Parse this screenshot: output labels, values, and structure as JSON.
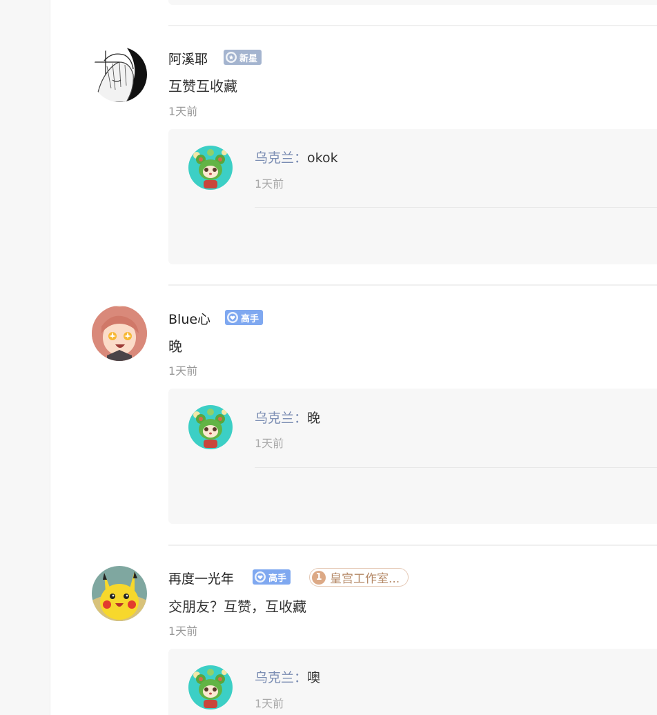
{
  "comments": [
    {
      "username": "阿溪耶",
      "badge": {
        "type": "star",
        "label": "新星"
      },
      "text": "互赞互收藏",
      "time": "1天前",
      "avatar": "sketch-girl-avatar",
      "replies": [
        {
          "username": "乌克兰",
          "separator": "：",
          "text": "okok",
          "time": "1天前",
          "avatar": "green-bear-avatar"
        }
      ]
    },
    {
      "username": "Blue心",
      "badge": {
        "type": "pro",
        "label": "高手"
      },
      "text": "晚",
      "time": "1天前",
      "avatar": "anime-girl-avatar",
      "replies": [
        {
          "username": "乌克兰",
          "separator": "：",
          "text": "晚",
          "time": "1天前",
          "avatar": "green-bear-avatar"
        }
      ]
    },
    {
      "username": "再度一光年",
      "badge": {
        "type": "pro",
        "label": "高手"
      },
      "studio_badge": {
        "rank": "1",
        "label": "皇宫工作室..."
      },
      "text": "交朋友？互赞，互收藏",
      "time": "1天前",
      "avatar": "pikachu-avatar",
      "replies": [
        {
          "username": "乌克兰",
          "separator": "：",
          "text": "噢",
          "time": "1天前",
          "avatar": "green-bear-avatar"
        }
      ]
    }
  ],
  "colors": {
    "reply_name": "#7b8db3",
    "badge_star": "#a4b4cf",
    "badge_pro": "#7fa8f0",
    "studio_badge": "#dca986"
  }
}
